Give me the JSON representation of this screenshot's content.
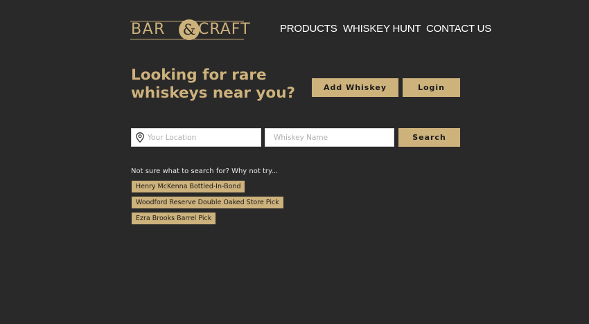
{
  "brand": {
    "logo_left": "BAR",
    "logo_amp": "&",
    "logo_right": "CRAFT",
    "accent_color": "#cdb27c",
    "background_color": "#2a2929"
  },
  "nav": {
    "items": [
      {
        "label": "PRODUCTS"
      },
      {
        "label": "WHISKEY HUNT"
      },
      {
        "label": "CONTACT US"
      }
    ]
  },
  "hero": {
    "headline": "Looking for rare whiskeys near you?",
    "add_whiskey_label": "Add Whiskey",
    "login_label": "Login"
  },
  "search": {
    "location_icon": "map-pin-icon",
    "location_placeholder": "Your Location",
    "location_value": "",
    "whiskey_placeholder": "Whiskey Name",
    "whiskey_value": "",
    "button_label": "Search"
  },
  "suggestions": {
    "label": "Not sure what to search for? Why not try...",
    "items": [
      {
        "label": "Henry McKenna Bottled-In-Bond"
      },
      {
        "label": "Woodford Reserve Double Oaked Store Pick"
      },
      {
        "label": "Ezra Brooks Barrel Pick"
      }
    ]
  }
}
